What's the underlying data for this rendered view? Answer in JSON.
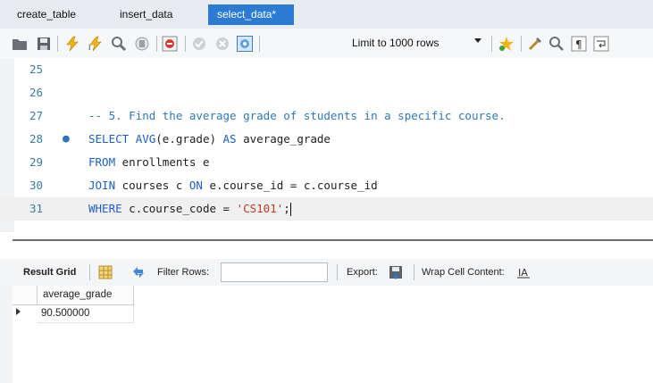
{
  "tabs": [
    {
      "label": "create_table",
      "active": false
    },
    {
      "label": "insert_data",
      "active": false
    },
    {
      "label": "select_data*",
      "active": true
    }
  ],
  "toolbar": {
    "icons": [
      "open-folder-icon",
      "save-icon",
      "execute-icon",
      "execute-current-icon",
      "explain-icon",
      "stop-icon",
      "toggle-error-icon",
      "commit-icon",
      "rollback-icon",
      "autocommit-icon",
      "beautify-icon",
      "find-icon",
      "invisible-chars-icon",
      "wrap-icon",
      "favorite-icon"
    ],
    "limit_label": "Limit to 1000 rows"
  },
  "editor": {
    "lines": [
      {
        "num": "25",
        "tokens": []
      },
      {
        "num": "26",
        "tokens": []
      },
      {
        "num": "27",
        "tokens": [
          {
            "cls": "cmt",
            "text": "-- 5. Find the average grade of students in a specific course."
          }
        ]
      },
      {
        "num": "28",
        "marker": "●",
        "tokens": [
          {
            "cls": "kw",
            "text": "SELECT"
          },
          {
            "cls": "",
            "text": " "
          },
          {
            "cls": "kw",
            "text": "AVG"
          },
          {
            "cls": "",
            "text": "(e.grade) "
          },
          {
            "cls": "kw",
            "text": "AS"
          },
          {
            "cls": "",
            "text": " average_grade"
          }
        ]
      },
      {
        "num": "29",
        "tokens": [
          {
            "cls": "kw",
            "text": "FROM"
          },
          {
            "cls": "",
            "text": " enrollments e"
          }
        ]
      },
      {
        "num": "30",
        "tokens": [
          {
            "cls": "kw",
            "text": "JOIN"
          },
          {
            "cls": "",
            "text": " courses c "
          },
          {
            "cls": "kw",
            "text": "ON"
          },
          {
            "cls": "",
            "text": " e.course_id = c.course_id"
          }
        ]
      },
      {
        "num": "31",
        "current": true,
        "tokens": [
          {
            "cls": "kw",
            "text": "WHERE"
          },
          {
            "cls": "",
            "text": " c.course_code = "
          },
          {
            "cls": "str",
            "text": "'CS101'"
          },
          {
            "cls": "",
            "text": ";"
          }
        ]
      }
    ]
  },
  "result": {
    "title": "Result Grid",
    "filter_label": "Filter Rows:",
    "filter_value": "",
    "export_label": "Export:",
    "wrap_label": "Wrap Cell Content:",
    "columns": [
      "average_grade"
    ],
    "rows": [
      [
        "90.500000"
      ]
    ]
  },
  "colors": {
    "active_tab": "#2a7bd1",
    "keyword": "#1d5ec8",
    "comment": "#2e78b7",
    "string": "#c03a1f"
  }
}
